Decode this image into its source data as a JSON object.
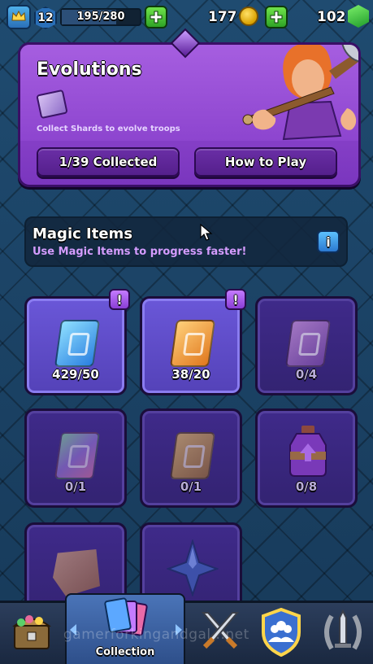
{
  "topbar": {
    "level": "12",
    "xp": "195/280",
    "xp_progress": 0.696,
    "gold": "177",
    "gems": "102"
  },
  "evolutions": {
    "title": "Evolutions",
    "subtitle": "Collect Shards to evolve troops",
    "collected_button": "1/39 Collected",
    "how_to_play_button": "How to Play"
  },
  "magic_items": {
    "title": "Magic Items",
    "subtitle": "Use Magic Items to progress faster!",
    "info_label": "i",
    "items": [
      {
        "icon": "book-of-cards-icon",
        "count": "429/50",
        "state": "ready",
        "alert": "!"
      },
      {
        "icon": "book-of-books-icon",
        "count": "38/20",
        "state": "ready",
        "alert": "!"
      },
      {
        "icon": "book-of-fortune-icon",
        "count": "0/4",
        "state": "empty"
      },
      {
        "icon": "book-of-rainbow-icon",
        "count": "0/1",
        "state": "empty"
      },
      {
        "icon": "book-of-gold-icon",
        "count": "0/1",
        "state": "empty"
      },
      {
        "icon": "elixir-bottle-icon",
        "count": "0/8",
        "state": "empty"
      },
      {
        "icon": "wild-shard-icon",
        "count": "",
        "state": "empty"
      },
      {
        "icon": "star-shard-icon",
        "count": "",
        "state": "empty"
      }
    ]
  },
  "bottom_nav": {
    "tabs": [
      {
        "name": "shop",
        "icon": "treasure-chest-icon",
        "label": ""
      },
      {
        "name": "collection",
        "icon": "cards-icon",
        "label": "Collection"
      },
      {
        "name": "battle",
        "icon": "crossed-swords-icon",
        "label": ""
      },
      {
        "name": "social",
        "icon": "clan-shield-icon",
        "label": ""
      },
      {
        "name": "events",
        "icon": "laurel-sword-icon",
        "label": ""
      }
    ]
  },
  "watermark": "gamerforkingandgal...net",
  "colors": {
    "panel_purple": "#8d45cf",
    "accent_green": "#2fa326",
    "gold": "#d9a100",
    "subtitle_pink": "#d59cff"
  }
}
